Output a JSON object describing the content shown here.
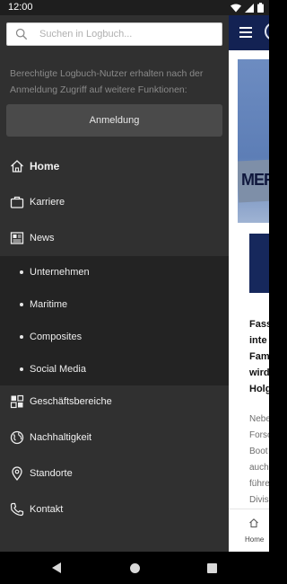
{
  "status_bar": {
    "time": "12:00"
  },
  "search": {
    "placeholder": "Suchen in Logbuch..."
  },
  "drawer": {
    "info_text": "Berechtigte Logbuch-Nutzer erhalten nach der Anmeldung Zugriff auf weitere Funktionen:",
    "login_label": "Anmeldung",
    "items": [
      {
        "label": "Home",
        "icon": "home-icon"
      },
      {
        "label": "Karriere",
        "icon": "briefcase-icon"
      },
      {
        "label": "News",
        "icon": "newspaper-icon"
      },
      {
        "label": "Geschäftsbereiche",
        "icon": "grid-icon"
      },
      {
        "label": "Nachhaltigkeit",
        "icon": "globe-icon"
      },
      {
        "label": "Standorte",
        "icon": "location-pin-icon"
      },
      {
        "label": "Kontakt",
        "icon": "phone-icon"
      }
    ],
    "news_subitems": [
      {
        "label": "Unternehmen"
      },
      {
        "label": "Maritime"
      },
      {
        "label": "Composites"
      },
      {
        "label": "Social Media"
      }
    ]
  },
  "app": {
    "hero_text": "MER",
    "headline_lines": [
      "Fass",
      "inte",
      "Fam",
      "wird",
      "Holg"
    ],
    "body_lines": [
      "Nebe",
      "Forso",
      "Boot",
      "auch",
      "führe",
      "Divis"
    ],
    "bottom_nav_label": "Home"
  },
  "colors": {
    "drawer_bg": "#303030",
    "subnav_bg": "#232323",
    "brand_navy": "#132253",
    "button_bg": "#4a4a4a"
  }
}
